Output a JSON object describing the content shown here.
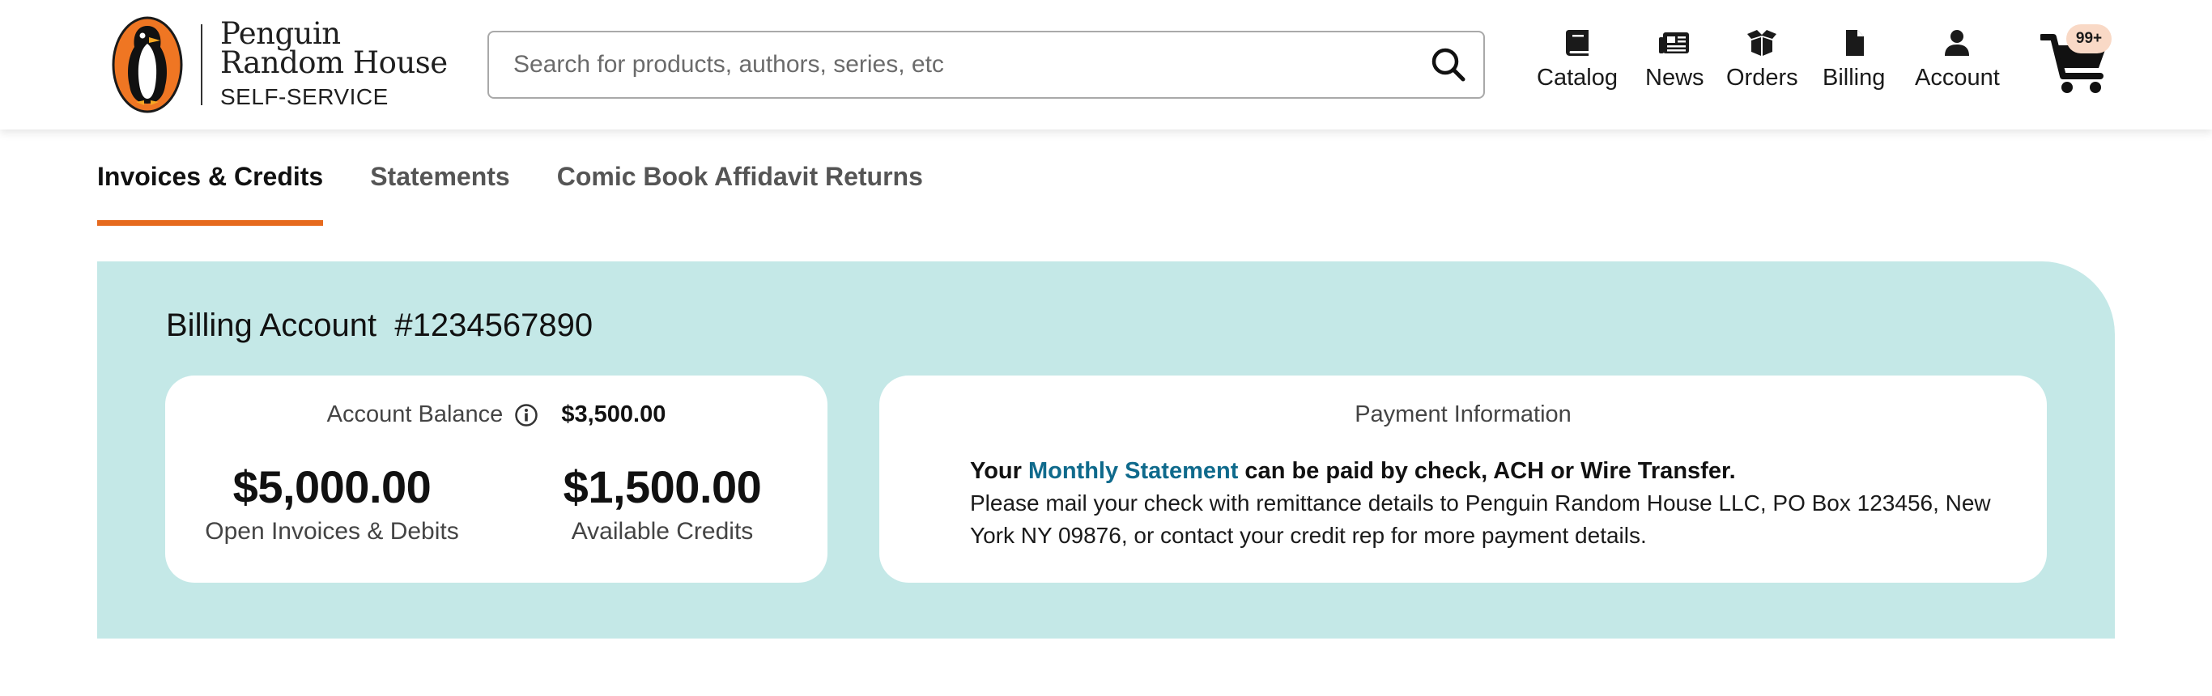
{
  "brand": {
    "line1": "Penguin",
    "line2": "Random House",
    "sub": "SELF-SERVICE"
  },
  "search": {
    "placeholder": "Search for products, authors, series, etc"
  },
  "nav": {
    "catalog": "Catalog",
    "news": "News",
    "orders": "Orders",
    "billing": "Billing",
    "account": "Account"
  },
  "cart": {
    "badge": "99+"
  },
  "tabs": {
    "invoices": "Invoices & Credits",
    "statements": "Statements",
    "comic": "Comic Book Affidavit Returns"
  },
  "billing": {
    "title": "Billing Account  #1234567890",
    "balance_label": "Account Balance",
    "balance_value": "$3,500.00",
    "open_amount": "$5,000.00",
    "open_label": "Open Invoices & Debits",
    "credits_amount": "$1,500.00",
    "credits_label": "Available Credits"
  },
  "payment": {
    "title": "Payment Information",
    "lead_before": "Your ",
    "link": "Monthly Statement",
    "lead_after": " can be paid by check, ACH or Wire Transfer.",
    "body": "Please mail your check with remittance details to Penguin Random House LLC, PO Box 123456, New York NY 09876, or contact your credit rep for more payment details."
  },
  "colors": {
    "accent": "#e66a1e",
    "panel": "#c4e8e7",
    "link": "#0f6a8c",
    "badge": "#f9d9c6"
  }
}
